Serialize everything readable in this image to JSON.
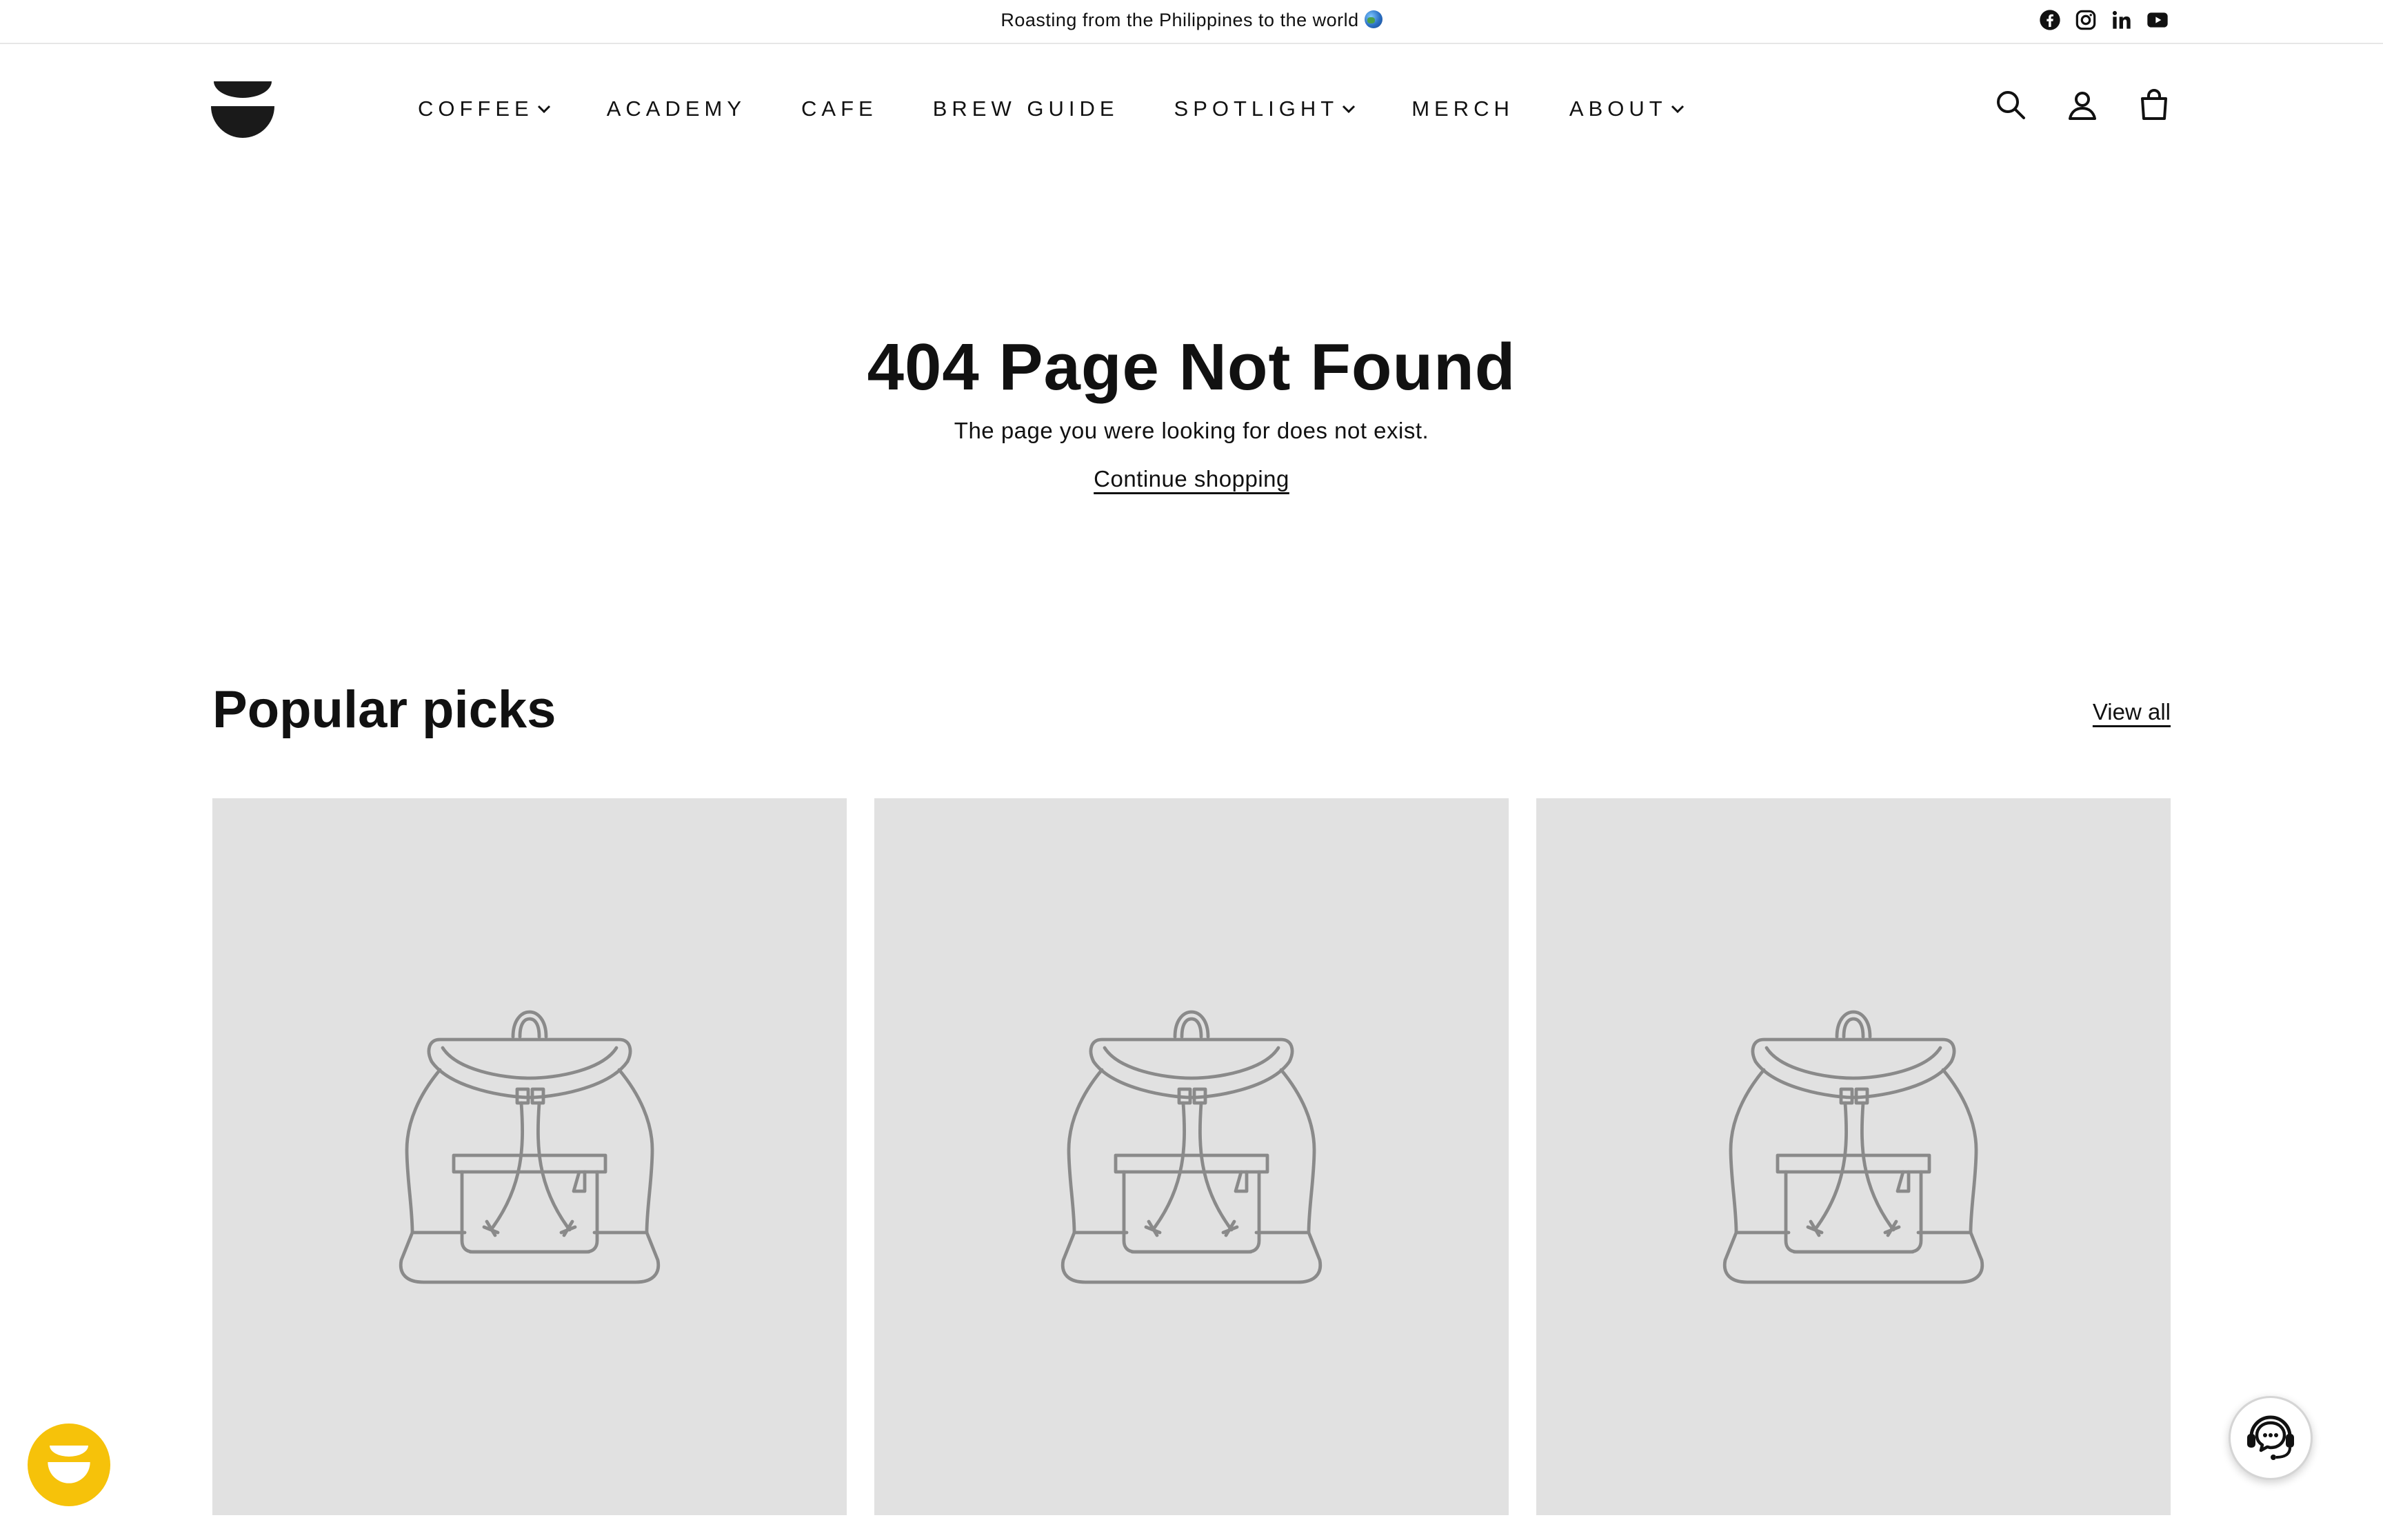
{
  "announcement": {
    "text": "Roasting from the Philippines to the world",
    "globe_icon": "globe-emoji"
  },
  "socials": [
    {
      "name": "facebook-icon"
    },
    {
      "name": "instagram-icon"
    },
    {
      "name": "linkedin-icon"
    },
    {
      "name": "youtube-icon"
    }
  ],
  "nav": {
    "coffee": "COFFEE",
    "academy": "ACADEMY",
    "cafe": "CAFE",
    "brew_guide": "BREW GUIDE",
    "spotlight": "SPOTLIGHT",
    "merch": "MERCH",
    "about": "ABOUT"
  },
  "header_icons": [
    "search-icon",
    "account-icon",
    "cart-icon"
  ],
  "not_found": {
    "title": "404 Page Not Found",
    "subtitle": "The page you were looking for does not exist.",
    "link": "Continue shopping"
  },
  "popular": {
    "title": "Popular picks",
    "view_all": "View all",
    "cards": [
      {
        "image": "backpack-placeholder"
      },
      {
        "image": "backpack-placeholder"
      },
      {
        "image": "backpack-placeholder"
      }
    ]
  },
  "colors": {
    "accent_yellow": "#f6c20a",
    "placeholder_bg": "#e1e1e1",
    "placeholder_stroke": "#8a8a8a",
    "text": "#111111"
  }
}
